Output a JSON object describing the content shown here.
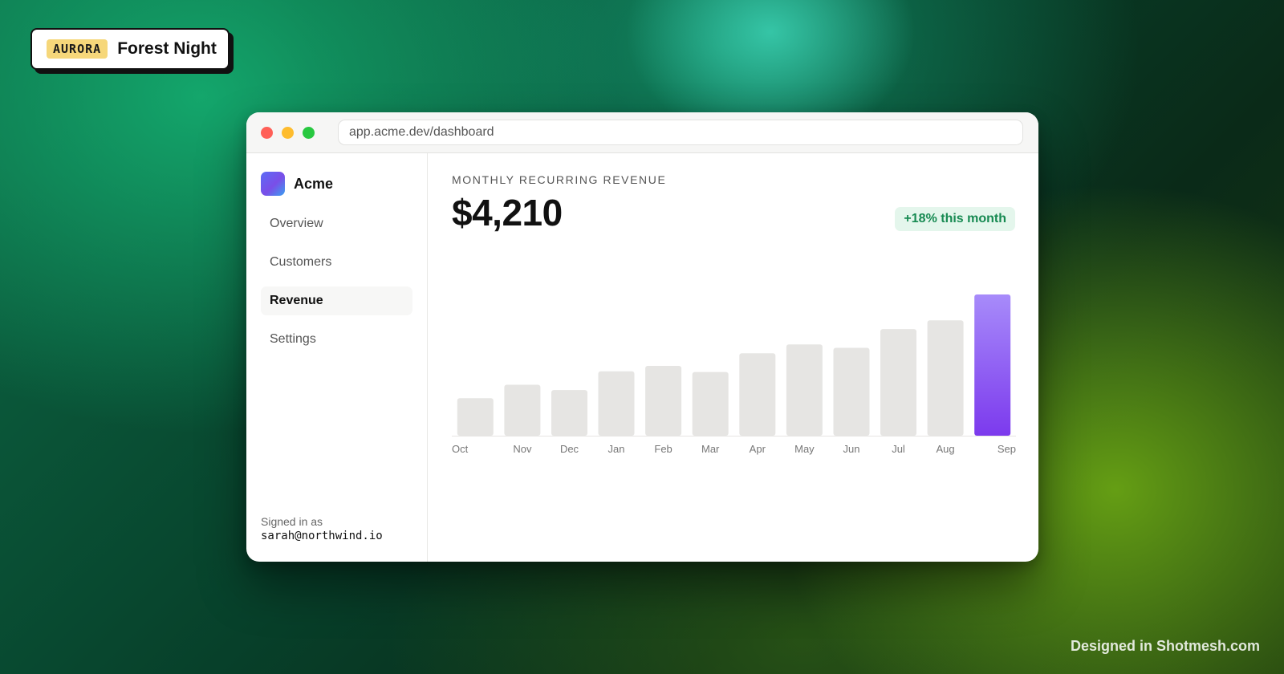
{
  "tag": {
    "badge": "AURORA",
    "title": "Forest Night"
  },
  "browser": {
    "url": "app.acme.dev/dashboard"
  },
  "sidebar": {
    "org_name": "Acme",
    "items": [
      {
        "label": "Overview"
      },
      {
        "label": "Customers"
      },
      {
        "label": "Revenue"
      },
      {
        "label": "Settings"
      }
    ],
    "signed_in_label": "Signed in as",
    "user_email": "sarah@northwind.io"
  },
  "main": {
    "metric_label": "MONTHLY RECURRING REVENUE",
    "metric_value": "$4,210",
    "delta": "+18% this month"
  },
  "colors": {
    "bar": "#e6e5e3",
    "highlight_bar_top": "#a78bfa",
    "highlight_bar_bottom": "#7c3aed",
    "delta_text": "#178a52",
    "delta_bg": "#e4f6ec"
  },
  "chart_data": {
    "type": "bar",
    "categories": [
      "Oct",
      "Nov",
      "Dec",
      "Jan",
      "Feb",
      "Mar",
      "Apr",
      "May",
      "Jun",
      "Jul",
      "Aug",
      "Sep"
    ],
    "values": [
      1120,
      1520,
      1360,
      1920,
      2080,
      1900,
      2460,
      2720,
      2620,
      3180,
      3440,
      4210
    ],
    "highlight": "Sep",
    "ylim": [
      0,
      4210
    ],
    "grid": false,
    "title": "",
    "xlabel": "",
    "ylabel": ""
  },
  "footer": {
    "credit": "Designed in Shotmesh.com"
  }
}
